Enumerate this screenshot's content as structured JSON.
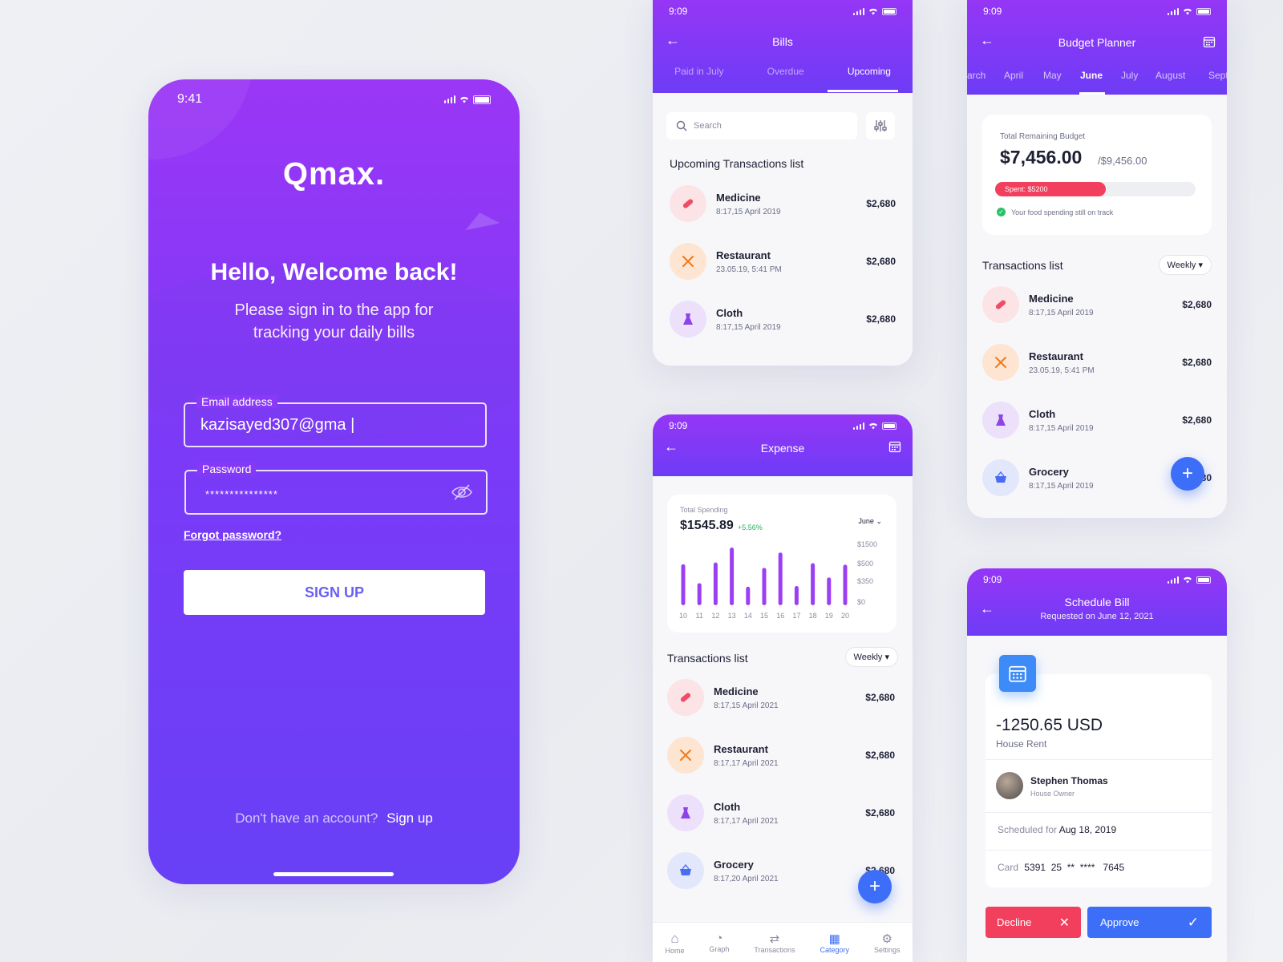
{
  "login": {
    "time": "9:41",
    "logo": "Qmax.",
    "title": "Hello, Welcome back!",
    "subtitle_line1": "Please sign in to the app for",
    "subtitle_line2": "tracking your daily bills",
    "email_label": "Email address",
    "email_value": "kazisayed307@gma |",
    "password_label": "Password",
    "password_value": "***************",
    "forgot": "Forgot password?",
    "signup_button": "SIGN UP",
    "no_account": "Don't have an account?",
    "signup_link": "Sign up",
    "eye_icon": "eye-off-icon"
  },
  "bills": {
    "time": "9:09",
    "title": "Bills",
    "tabs": [
      "Paid in July",
      "Overdue",
      "Upcoming"
    ],
    "active_tab": "Upcoming",
    "search_placeholder": "Search",
    "section": "Upcoming Transactions list",
    "items": [
      {
        "name": "Medicine",
        "date": "8:17,15 April 2019",
        "amount": "$2,680",
        "icon": "pill-icon"
      },
      {
        "name": "Restaurant",
        "date": "23.05.19, 5:41 PM",
        "amount": "$2,680",
        "icon": "cutlery-icon"
      },
      {
        "name": "Cloth",
        "date": "8:17,15 April 2019",
        "amount": "$2,680",
        "icon": "dress-icon"
      }
    ]
  },
  "expense": {
    "time": "9:09",
    "title": "Expense",
    "total_label": "Total Spending",
    "total_value": "$1545.89",
    "change": "+5.56%",
    "month": "June",
    "section": "Transactions list",
    "filter": "Weekly",
    "items": [
      {
        "name": "Medicine",
        "date": "8:17,15 April 2021",
        "amount": "$2,680",
        "icon": "pill-icon"
      },
      {
        "name": "Restaurant",
        "date": "8:17,17 April 2021",
        "amount": "$2,680",
        "icon": "cutlery-icon"
      },
      {
        "name": "Cloth",
        "date": "8:17,17 April 2021",
        "amount": "$2,680",
        "icon": "dress-icon"
      },
      {
        "name": "Grocery",
        "date": "8:17,20 April 2021",
        "amount": "$2,680",
        "icon": "basket-icon"
      }
    ],
    "nav": [
      "Home",
      "Graph",
      "Transactions",
      "Category",
      "Settings"
    ],
    "nav_active": "Category"
  },
  "chart_data": {
    "type": "bar",
    "categories": [
      "10",
      "11",
      "12",
      "13",
      "14",
      "15",
      "16",
      "17",
      "18",
      "19",
      "20"
    ],
    "values": [
      1150,
      620,
      1200,
      1620,
      520,
      1050,
      1480,
      540,
      1180,
      780,
      1140
    ],
    "y_ticks": [
      "$1500",
      "$500",
      "$350",
      "$0"
    ],
    "ylim": [
      0,
      1800
    ],
    "accent": "#9c3ff2"
  },
  "budget": {
    "time": "9:09",
    "title": "Budget Planner",
    "months": [
      "arch",
      "April",
      "May",
      "June",
      "July",
      "August",
      "Sept"
    ],
    "active_month": "June",
    "remaining_label": "Total Remaining Budget",
    "remaining_value": "$7,456.00",
    "total": "/$9,456.00",
    "spent_label": "Spent: $5200",
    "spent_fraction": 0.55,
    "track_note": "Your food spending still on track",
    "section": "Transactions list",
    "filter": "Weekly",
    "items": [
      {
        "name": "Medicine",
        "date": "8:17,15 April 2019",
        "amount": "$2,680",
        "icon": "pill-icon"
      },
      {
        "name": "Restaurant",
        "date": "23.05.19, 5:41 PM",
        "amount": "$2,680",
        "icon": "cutlery-icon"
      },
      {
        "name": "Cloth",
        "date": "8:17,15 April 2019",
        "amount": "$2,680",
        "icon": "dress-icon"
      },
      {
        "name": "Grocery",
        "date": "8:17,15 April 2019",
        "amount": "$2,680",
        "icon": "basket-icon"
      }
    ]
  },
  "schedule": {
    "time": "9:09",
    "title": "Schedule Bill",
    "subtitle": "Requested on June 12, 2021",
    "amount": "-1250.65 USD",
    "category": "House Rent",
    "person": "Stephen Thomas",
    "role": "House Owner",
    "scheduled_label": "Scheduled for",
    "scheduled_date": "Aug 18, 2019",
    "card_label": "Card",
    "card_number": "5391  25  **  ****   7645",
    "decline": "Decline",
    "approve": "Approve"
  },
  "colors": {
    "purple": "#8f38f5",
    "blue": "#3d6ef7",
    "red": "#f23f5d"
  }
}
